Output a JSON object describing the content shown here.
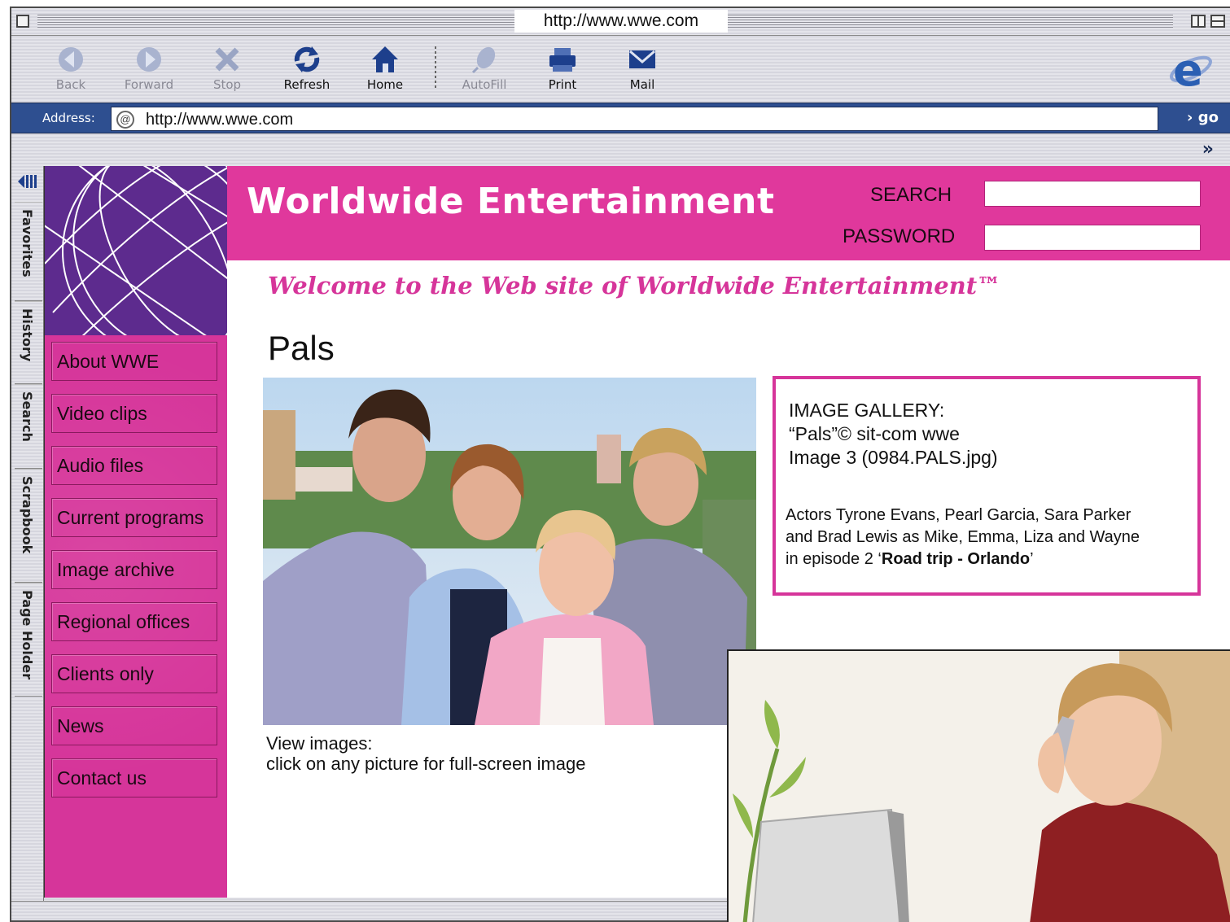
{
  "window": {
    "title": "http://www.wwe.com"
  },
  "toolbar": {
    "back": "Back",
    "forward": "Forward",
    "stop": "Stop",
    "refresh": "Refresh",
    "home": "Home",
    "autofill": "AutoFill",
    "print": "Print",
    "mail": "Mail"
  },
  "address": {
    "label": "Address:",
    "url": "http://www.wwe.com",
    "go": "go"
  },
  "explorer_tabs": [
    "Favorites",
    "History",
    "Search",
    "Scrapbook",
    "Page Holder"
  ],
  "site": {
    "title": "Worldwide Entertainment",
    "search_label": "SEARCH",
    "password_label": "PASSWORD",
    "welcome": "Welcome to the Web site of Worldwide Entertainment™",
    "content_title": "Pals"
  },
  "nav": [
    {
      "label": "About WWE"
    },
    {
      "label": "Video clips"
    },
    {
      "label": "Audio files"
    },
    {
      "label": "Current programs"
    },
    {
      "label": "Image archive"
    },
    {
      "label": "Regional offices"
    },
    {
      "label": "Clients only"
    },
    {
      "label": "News"
    },
    {
      "label": "Contact us"
    }
  ],
  "gallery": {
    "line1": "IMAGE GALLERY:",
    "line2": "“Pals”© sit-com wwe",
    "line3": "Image 3 (0984.PALS.jpg)",
    "desc_line1": "Actors Tyrone Evans, Pearl Garcia, Sara Parker",
    "desc_line2": "and Brad Lewis as Mike, Emma, Liza and Wayne",
    "desc_line3_pre": "in episode 2 ‘",
    "desc_line3_bold": "Road trip - Orlando",
    "desc_line3_post": "’"
  },
  "caption": {
    "line1": "View images:",
    "line2": "click on any picture for full-screen image"
  },
  "colors": {
    "brand_pink": "#e0389c",
    "nav_pink": "#d6359a",
    "globe_purple": "#5d2b8e",
    "address_blue": "#2e4f90"
  }
}
